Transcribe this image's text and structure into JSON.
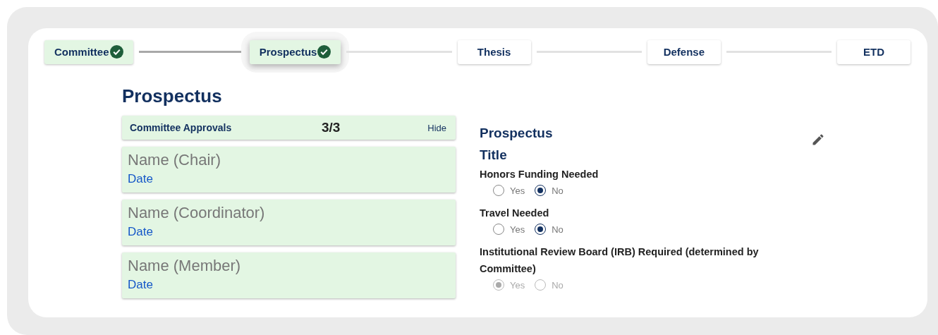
{
  "steps": [
    {
      "label": "Committee",
      "done": true,
      "selected": false
    },
    {
      "label": "Prospectus",
      "done": true,
      "selected": true
    },
    {
      "label": "Thesis",
      "done": false,
      "selected": false
    },
    {
      "label": "Defense",
      "done": false,
      "selected": false
    },
    {
      "label": "ETD",
      "done": false,
      "selected": false
    }
  ],
  "heading": "Prospectus",
  "approvals": {
    "title": "Committee Approvals",
    "count": "3/3",
    "toggle": "Hide",
    "members": [
      {
        "name": "Name (Chair)",
        "date": "Date"
      },
      {
        "name": "Name (Coordinator)",
        "date": "Date"
      },
      {
        "name": "Name (Member)",
        "date": "Date"
      }
    ]
  },
  "prospectus_title": {
    "label": "Prospectus Title"
  },
  "questions": [
    {
      "label": "Honors Funding Needed",
      "disabled": false,
      "options": [
        {
          "label": "Yes",
          "selected": false
        },
        {
          "label": "No",
          "selected": true
        }
      ]
    },
    {
      "label": "Travel Needed",
      "disabled": false,
      "options": [
        {
          "label": "Yes",
          "selected": false
        },
        {
          "label": "No",
          "selected": true
        }
      ]
    },
    {
      "label": "Institutional Review Board (IRB) Required (determined by Committee)",
      "disabled": true,
      "options": [
        {
          "label": "Yes",
          "selected": true
        },
        {
          "label": "No",
          "selected": false
        }
      ]
    }
  ]
}
